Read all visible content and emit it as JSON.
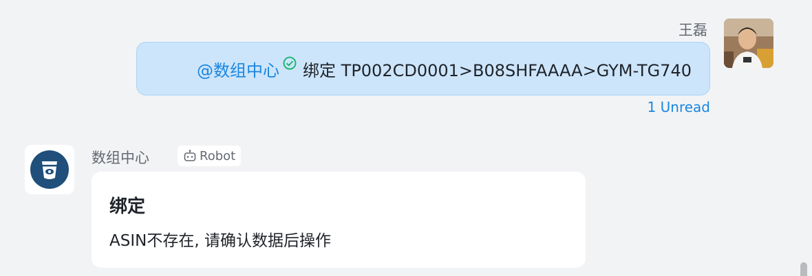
{
  "outgoing": {
    "sender_name": "王磊",
    "mention": "@数组中心",
    "message_text": "绑定 TP002CD0001>B08SHFAAAA>GYM-TG740",
    "unread_label": "1 Unread"
  },
  "incoming": {
    "sender_name": "数组中心",
    "badge_label": "Robot",
    "card": {
      "title": "绑定",
      "body": "ASIN不存在, 请确认数据后操作"
    }
  },
  "colors": {
    "accent": "#1a86e0",
    "bubble_bg": "#cce5fb",
    "check": "#22b573",
    "bot_avatar": "#1f4f7a"
  },
  "icons": {
    "read_check": "check-circle-icon",
    "robot": "robot-icon",
    "bot_logo": "bucket-logo-icon"
  }
}
